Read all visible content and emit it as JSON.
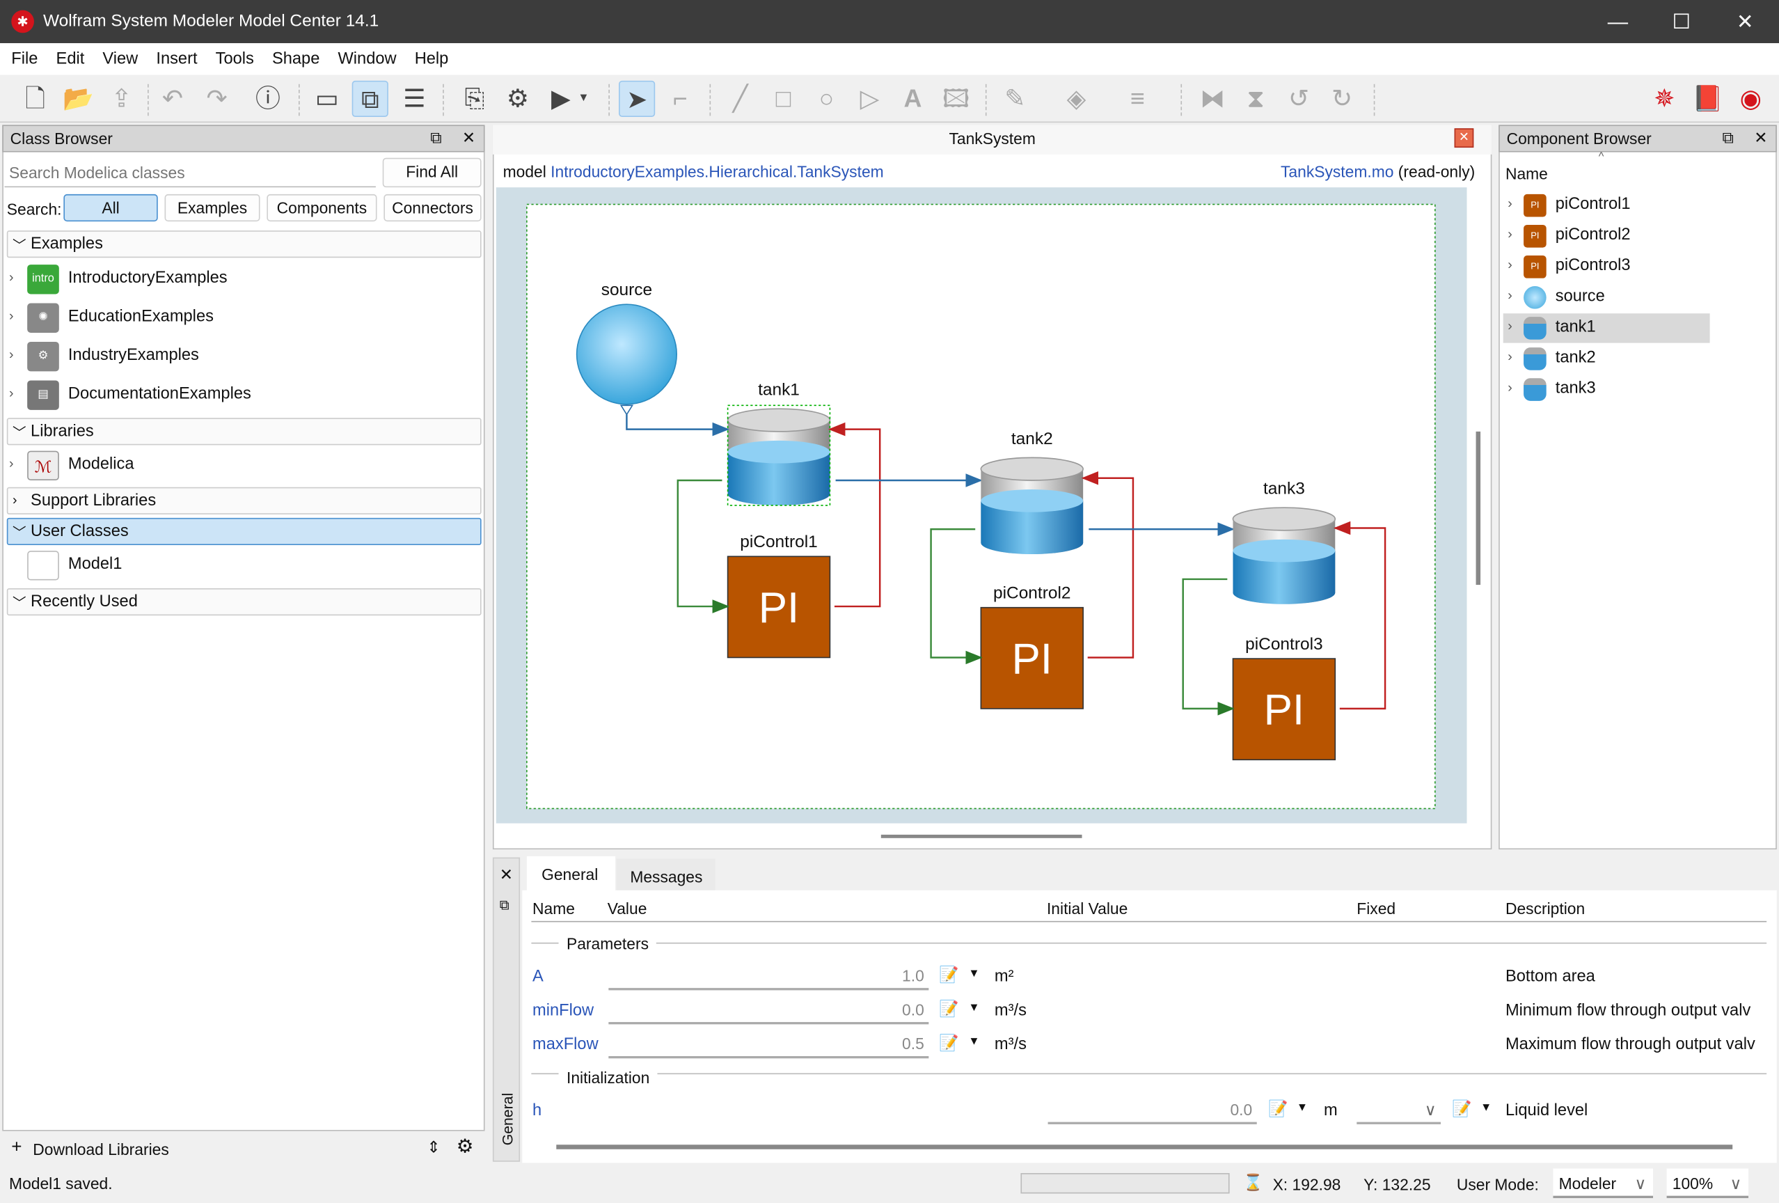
{
  "window": {
    "title": "Wolfram System Modeler Model Center 14.1",
    "minimize": "—",
    "maximize": "☐",
    "close": "✕"
  },
  "menu": [
    "File",
    "Edit",
    "View",
    "Insert",
    "Tools",
    "Shape",
    "Window",
    "Help"
  ],
  "toolbar": {
    "icons": [
      "new-file",
      "open-folder",
      "export",
      "undo",
      "redo",
      "info",
      "icon-view",
      "diagram-view",
      "text-view",
      "documentation",
      "check-model",
      "simulate",
      "simulate-dropdown",
      "select-arrow",
      "connect",
      "line",
      "rectangle",
      "ellipse",
      "polygon",
      "text",
      "bitmap",
      "line-color",
      "fill-color",
      "line-style",
      "flip-horizontal",
      "flip-vertical",
      "rotate-ccw",
      "rotate-cw",
      "wolfram-star",
      "documentation-center",
      "wolfram-community"
    ]
  },
  "class_browser": {
    "title": "Class Browser",
    "search_placeholder": "Search Modelica classes",
    "find_all": "Find All",
    "search_label": "Search:",
    "filters": [
      {
        "label": "All",
        "selected": true
      },
      {
        "label": "Examples"
      },
      {
        "label": "Components"
      },
      {
        "label": "Connectors"
      }
    ],
    "groups": {
      "examples": "Examples",
      "libraries": "Libraries",
      "support": "Support Libraries",
      "user": "User Classes",
      "recent": "Recently Used"
    },
    "example_items": [
      {
        "label": "IntroductoryExamples",
        "icon": "intro"
      },
      {
        "label": "EducationExamples"
      },
      {
        "label": "IndustryExamples"
      },
      {
        "label": "DocumentationExamples"
      }
    ],
    "library_items": [
      {
        "label": "Modelica"
      }
    ],
    "user_items": [
      {
        "label": "Model1"
      }
    ],
    "download": "Download Libraries",
    "status": "Model1 saved."
  },
  "editor": {
    "tab_title": "TankSystem",
    "model_keyword": "model",
    "model_path": "IntroductoryExamples.Hierarchical.TankSystem",
    "file_name": "TankSystem.mo",
    "file_state": "(read-only)",
    "diagram": {
      "source": "source",
      "tanks": [
        "tank1",
        "tank2",
        "tank3"
      ],
      "controllers": [
        "piControl1",
        "piControl2",
        "piControl3"
      ],
      "pi_text": "PI",
      "colors": {
        "flow": "#2a6ea8",
        "measure": "#3a8a3a",
        "control": "#c02020",
        "pi_fill": "#b85400",
        "selection": "#00b000"
      }
    }
  },
  "component_browser": {
    "title": "Component Browser",
    "column": "Name",
    "items": [
      {
        "label": "piControl1",
        "icon": "pi"
      },
      {
        "label": "piControl2",
        "icon": "pi"
      },
      {
        "label": "piControl3",
        "icon": "pi"
      },
      {
        "label": "source",
        "icon": "source"
      },
      {
        "label": "tank1",
        "icon": "tank",
        "selected": true
      },
      {
        "label": "tank2",
        "icon": "tank"
      },
      {
        "label": "tank3",
        "icon": "tank"
      }
    ]
  },
  "properties": {
    "tabs": [
      "General",
      "Messages"
    ],
    "side_tab": "General",
    "columns": [
      "Name",
      "Value",
      "Initial Value",
      "Fixed",
      "Description"
    ],
    "sections": {
      "parameters": "Parameters",
      "initialization": "Initialization"
    },
    "parameters": [
      {
        "name": "A",
        "value": "1.0",
        "unit": "m²",
        "description": "Bottom area"
      },
      {
        "name": "minFlow",
        "value": "0.0",
        "unit": "m³/s",
        "description": "Minimum flow through output valv"
      },
      {
        "name": "maxFlow",
        "value": "0.5",
        "unit": "m³/s",
        "description": "Maximum flow through output valv"
      }
    ],
    "initialization": [
      {
        "name": "h",
        "initial_value": "0.0",
        "unit": "m",
        "fixed": "",
        "description": "Liquid level"
      }
    ]
  },
  "statusbar": {
    "x": "X: 192.98",
    "y": "Y: 132.25",
    "user_mode_label": "User Mode:",
    "user_mode": "Modeler",
    "zoom": "100%"
  }
}
